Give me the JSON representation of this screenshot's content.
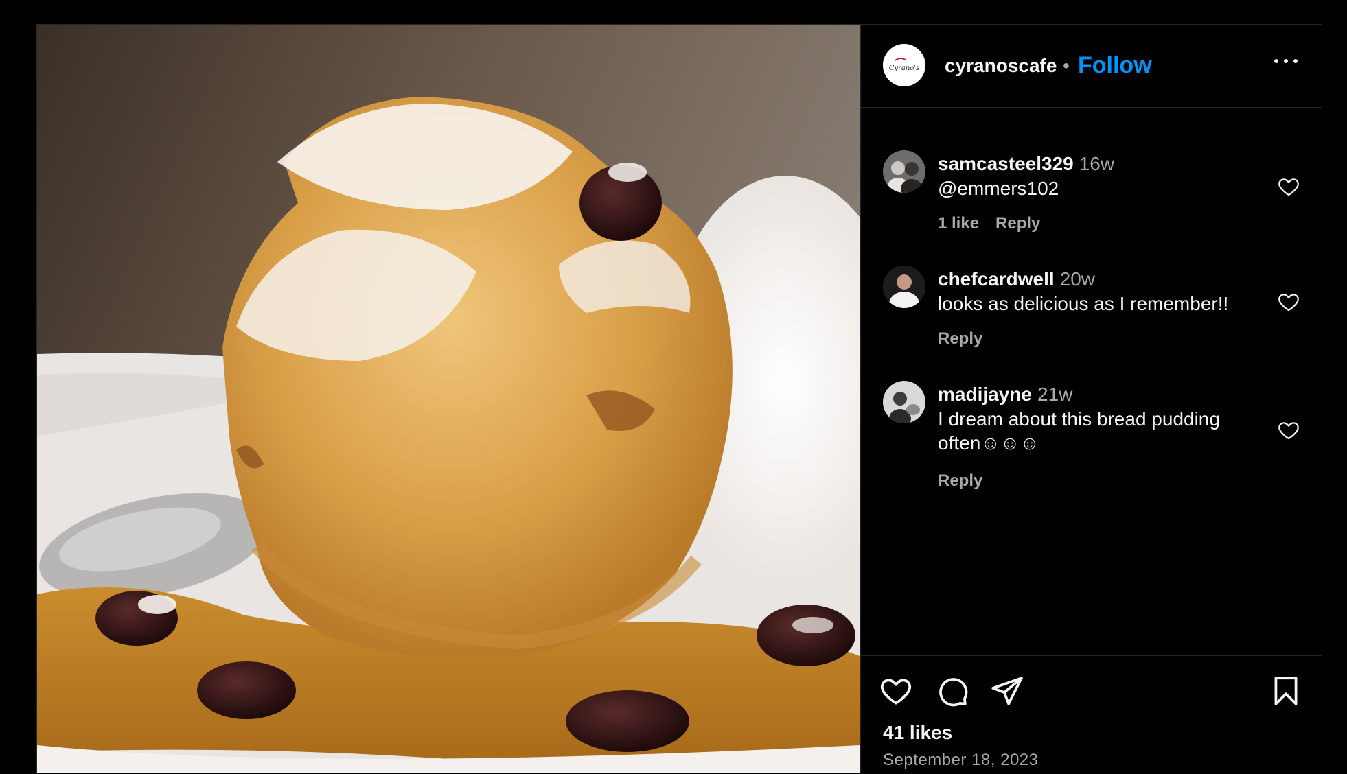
{
  "owner": {
    "username": "cyranoscafe",
    "separator": "•",
    "follow_label": "Follow",
    "logo_text": "Cyrano's"
  },
  "comments": [
    {
      "user": "samcasteel329",
      "time": "16w",
      "lines": [
        "@emmers102"
      ],
      "likes": "1 like",
      "reply": "Reply"
    },
    {
      "user": "chefcardwell",
      "time": "20w",
      "lines": [
        "looks as delicious as I remember!!"
      ],
      "reply": "Reply"
    },
    {
      "user": "madijayne",
      "time": "21w",
      "lines": [
        "I dream about this bread pudding",
        "often☺☺☺"
      ],
      "reply": "Reply"
    }
  ],
  "post": {
    "likes": "41 likes",
    "date": "September 18, 2023"
  },
  "icons": [
    "more-options-icon",
    "heart-icon",
    "comment-icon",
    "share-icon",
    "bookmark-icon"
  ],
  "colors": {
    "accent": "#0095f6",
    "background": "#000000",
    "text": "#f5f5f5",
    "muted": "#a8a8a8",
    "border": "#262626"
  }
}
